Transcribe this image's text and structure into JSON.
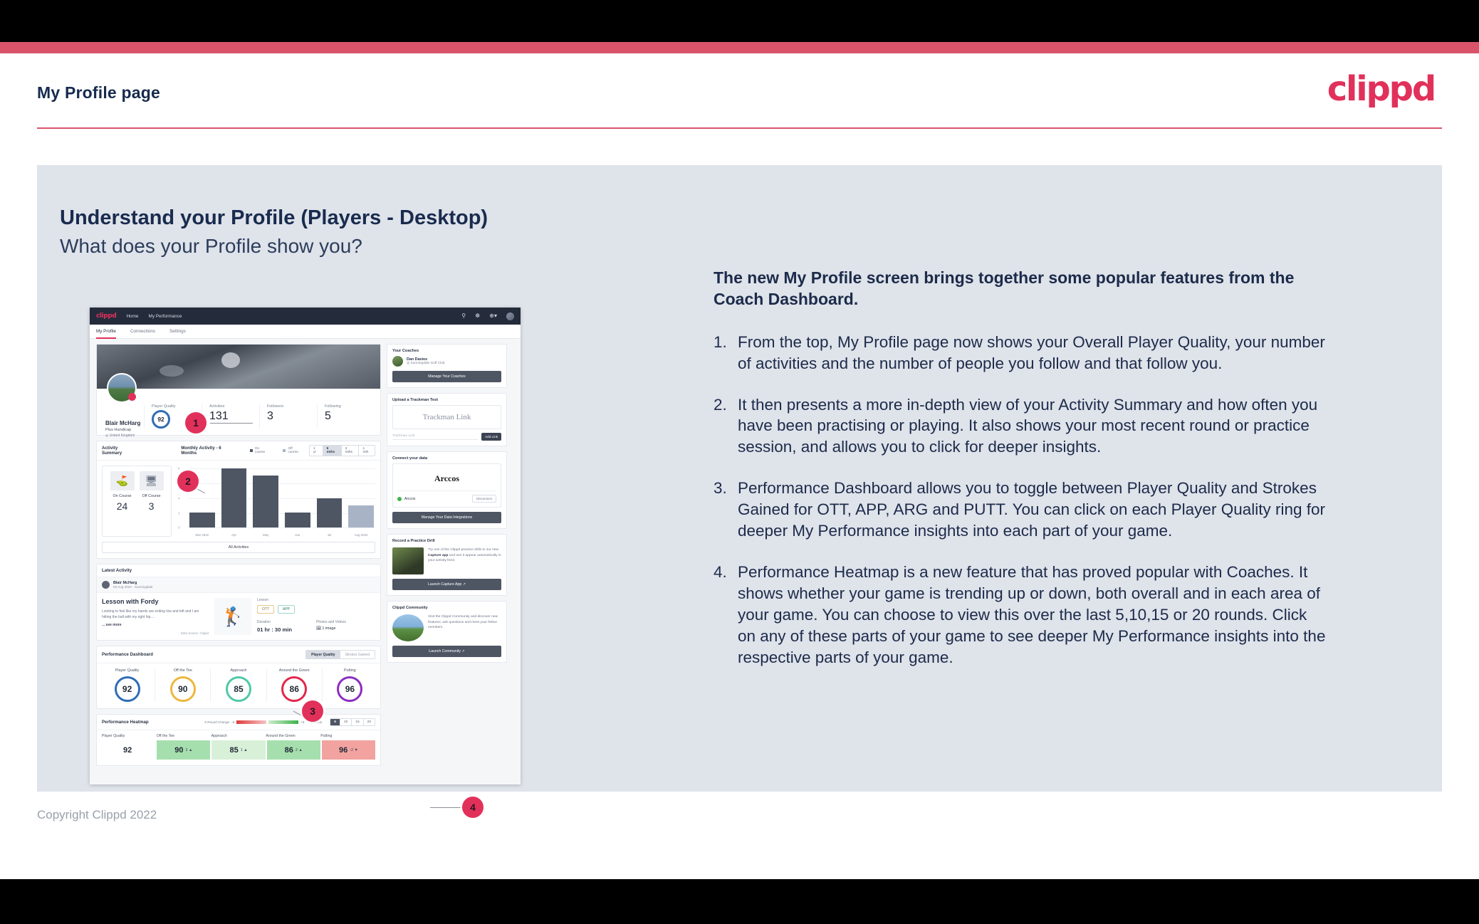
{
  "header": {
    "title": "My Profile page",
    "logo": "clippd"
  },
  "slide": {
    "heading": "Understand your Profile (Players - Desktop)",
    "subheading": "What does your Profile show you?",
    "footer": "Copyright Clippd 2022"
  },
  "copy": {
    "lead": "The new My Profile screen brings together some popular features from the Coach Dashboard.",
    "items": [
      {
        "num": "1.",
        "text": "From the top, My Profile page now shows your Overall Player Quality, your number of activities and the number of people you follow and that follow you."
      },
      {
        "num": "2.",
        "text": "It then presents a more in-depth view of your Activity Summary and how often you have been practising or playing. It also shows your most recent round or practice session, and allows you to click for deeper insights."
      },
      {
        "num": "3.",
        "text": "Performance Dashboard allows you to toggle between Player Quality and Strokes Gained for OTT, APP, ARG and PUTT. You can click on each Player Quality ring for deeper My Performance insights into each part of your game."
      },
      {
        "num": "4.",
        "text": "Performance Heatmap is a new feature that has proved popular with Coaches. It shows whether your game is trending up or down, both overall and in each area of your game. You can choose to view this over the last 5,10,15 or 20 rounds. Click on any of these parts of your game to see deeper My Performance insights into the respective parts of your game."
      }
    ]
  },
  "callouts": [
    {
      "label": "1"
    },
    {
      "label": "2"
    },
    {
      "label": "3"
    },
    {
      "label": "4"
    }
  ],
  "app": {
    "nav": {
      "logo": "clippd",
      "links": [
        "Home",
        "My Performance"
      ],
      "icons": [
        "search-icon",
        "community-icon",
        "add-icon",
        "avatar-icon"
      ]
    },
    "tabs": [
      {
        "label": "My Profile",
        "active": true
      },
      {
        "label": "Connections",
        "active": false
      },
      {
        "label": "Settings",
        "active": false
      }
    ],
    "profile": {
      "name": "Blair McHarg",
      "handicap": "Plus Handicap",
      "location": "United Kingdom",
      "stats": [
        {
          "label": "Player Quality",
          "value": "92",
          "type": "ring",
          "color": "#2f6cb5"
        },
        {
          "label": "Activities",
          "value": "131",
          "type": "number"
        },
        {
          "label": "Followers",
          "value": "3",
          "type": "number"
        },
        {
          "label": "Following",
          "value": "5",
          "type": "number"
        }
      ]
    },
    "activity_summary": {
      "title": "Activity Summary",
      "chart_title": "Monthly Activity - 6 Months",
      "legend": [
        {
          "label": "On course",
          "color": "#4e5664"
        },
        {
          "label": "Off course",
          "color": "#a8b4c6"
        }
      ],
      "range_options": [
        "1 yr",
        "6 mths",
        "3 mths",
        "1 mth"
      ],
      "range_selected": "6 mths",
      "counters": [
        {
          "label": "On Course",
          "value": "24",
          "icon": "golf-flag-icon"
        },
        {
          "label": "Off Course",
          "value": "3",
          "icon": "monitor-icon"
        }
      ],
      "all_activities_label": "All Activities"
    },
    "latest_activity": {
      "section_title": "Latest Activity",
      "user": "Blair McHarg",
      "meta": "03 Aug 2022 - Sunningdale",
      "title": "Lesson with Fordy",
      "description": "Looking to feel like my hands are exiting low and left and I am hitting the ball with my right hip....",
      "see_more": "... see more",
      "source": "Data Source: Clippd",
      "type_label": "Lesson",
      "tags": [
        "OTT",
        "APP"
      ],
      "duration_label": "Duration",
      "duration_value": "01 hr : 30 min",
      "media_label": "Photos and Videos",
      "media_value": "1 image"
    },
    "performance_dashboard": {
      "title": "Performance Dashboard",
      "toggle": [
        "Player Quality",
        "Strokes Gained"
      ],
      "toggle_selected": "Player Quality",
      "rings": [
        {
          "label": "Player Quality",
          "value": "92",
          "color": "#2f6cb5"
        },
        {
          "label": "Off the Tee",
          "value": "90",
          "color": "#edb73e"
        },
        {
          "label": "Approach",
          "value": "85",
          "color": "#4fc9a7"
        },
        {
          "label": "Around the Green",
          "value": "86",
          "color": "#e0294b"
        },
        {
          "label": "Putting",
          "value": "96",
          "color": "#8d2ec0"
        }
      ]
    },
    "performance_heatmap": {
      "title": "Performance Heatmap",
      "scale_label": "5 Round Change",
      "scale_min": "-5",
      "scale_max": "+5",
      "rounds_label": "Rounds",
      "rounds_options": [
        "5",
        "10",
        "15",
        "20"
      ],
      "rounds_selected": "5",
      "cells": [
        {
          "label": "Player Quality",
          "value": "92",
          "delta": "",
          "bg": "#ffffff"
        },
        {
          "label": "Off the Tee",
          "value": "90",
          "delta": "2 ▲",
          "bg": "#a6dfae"
        },
        {
          "label": "Approach",
          "value": "85",
          "delta": "1 ▲",
          "bg": "#d8f0d8"
        },
        {
          "label": "Around the Green",
          "value": "86",
          "delta": "2 ▲",
          "bg": "#a6dfae"
        },
        {
          "label": "Putting",
          "value": "96",
          "delta": "-2 ▼",
          "bg": "#f2a3a0"
        }
      ]
    },
    "sidebar": {
      "coaches": {
        "title": "Your Coaches",
        "coach_name": "Dan Davies",
        "coach_club": "Sunningdale Golf Club",
        "button": "Manage Your Coaches"
      },
      "trackman": {
        "title": "Upload a Trackman Test",
        "placeholder_logo": "Trackman Link",
        "input_placeholder": "Trackman Link",
        "button": "Add Link"
      },
      "connect": {
        "title": "Connect your data",
        "provider_logo": "Arccos",
        "provider_name": "Arccos",
        "status_button": "Disconnect",
        "button": "Manage Your Data Integrations"
      },
      "practice": {
        "title": "Record a Practice Drill",
        "text_before": "Try one of the Clippd practice drills in our new ",
        "text_bold": "Capture app",
        "text_after": " and see it appear automatically in your activity feed.",
        "button": "Launch Capture App"
      },
      "community": {
        "title": "Clippd Community",
        "text": "Visit the Clippd Community and discover new features, ask questions and meet your fellow members.",
        "button": "Launch Community"
      }
    }
  },
  "chart_data": {
    "type": "bar",
    "title": "Monthly Activity - 6 Months",
    "categories": [
      "Mar 2022",
      "Apr",
      "May",
      "Jun",
      "Jul",
      "Aug 2022"
    ],
    "values": [
      2,
      8,
      7,
      2,
      4,
      3
    ],
    "series": [
      {
        "name": "On course",
        "values": [
          2,
          8,
          7,
          2,
          4,
          null
        ],
        "color": "#4e5664"
      },
      {
        "name": "Off course",
        "values": [
          null,
          null,
          null,
          null,
          null,
          3
        ],
        "color": "#a8b4c6"
      }
    ],
    "yticks": [
      "0",
      "2",
      "4",
      "6",
      "8"
    ],
    "ylim": [
      0,
      8
    ],
    "xlabel": "",
    "ylabel": "",
    "grid": true,
    "legend_position": "top-right"
  }
}
